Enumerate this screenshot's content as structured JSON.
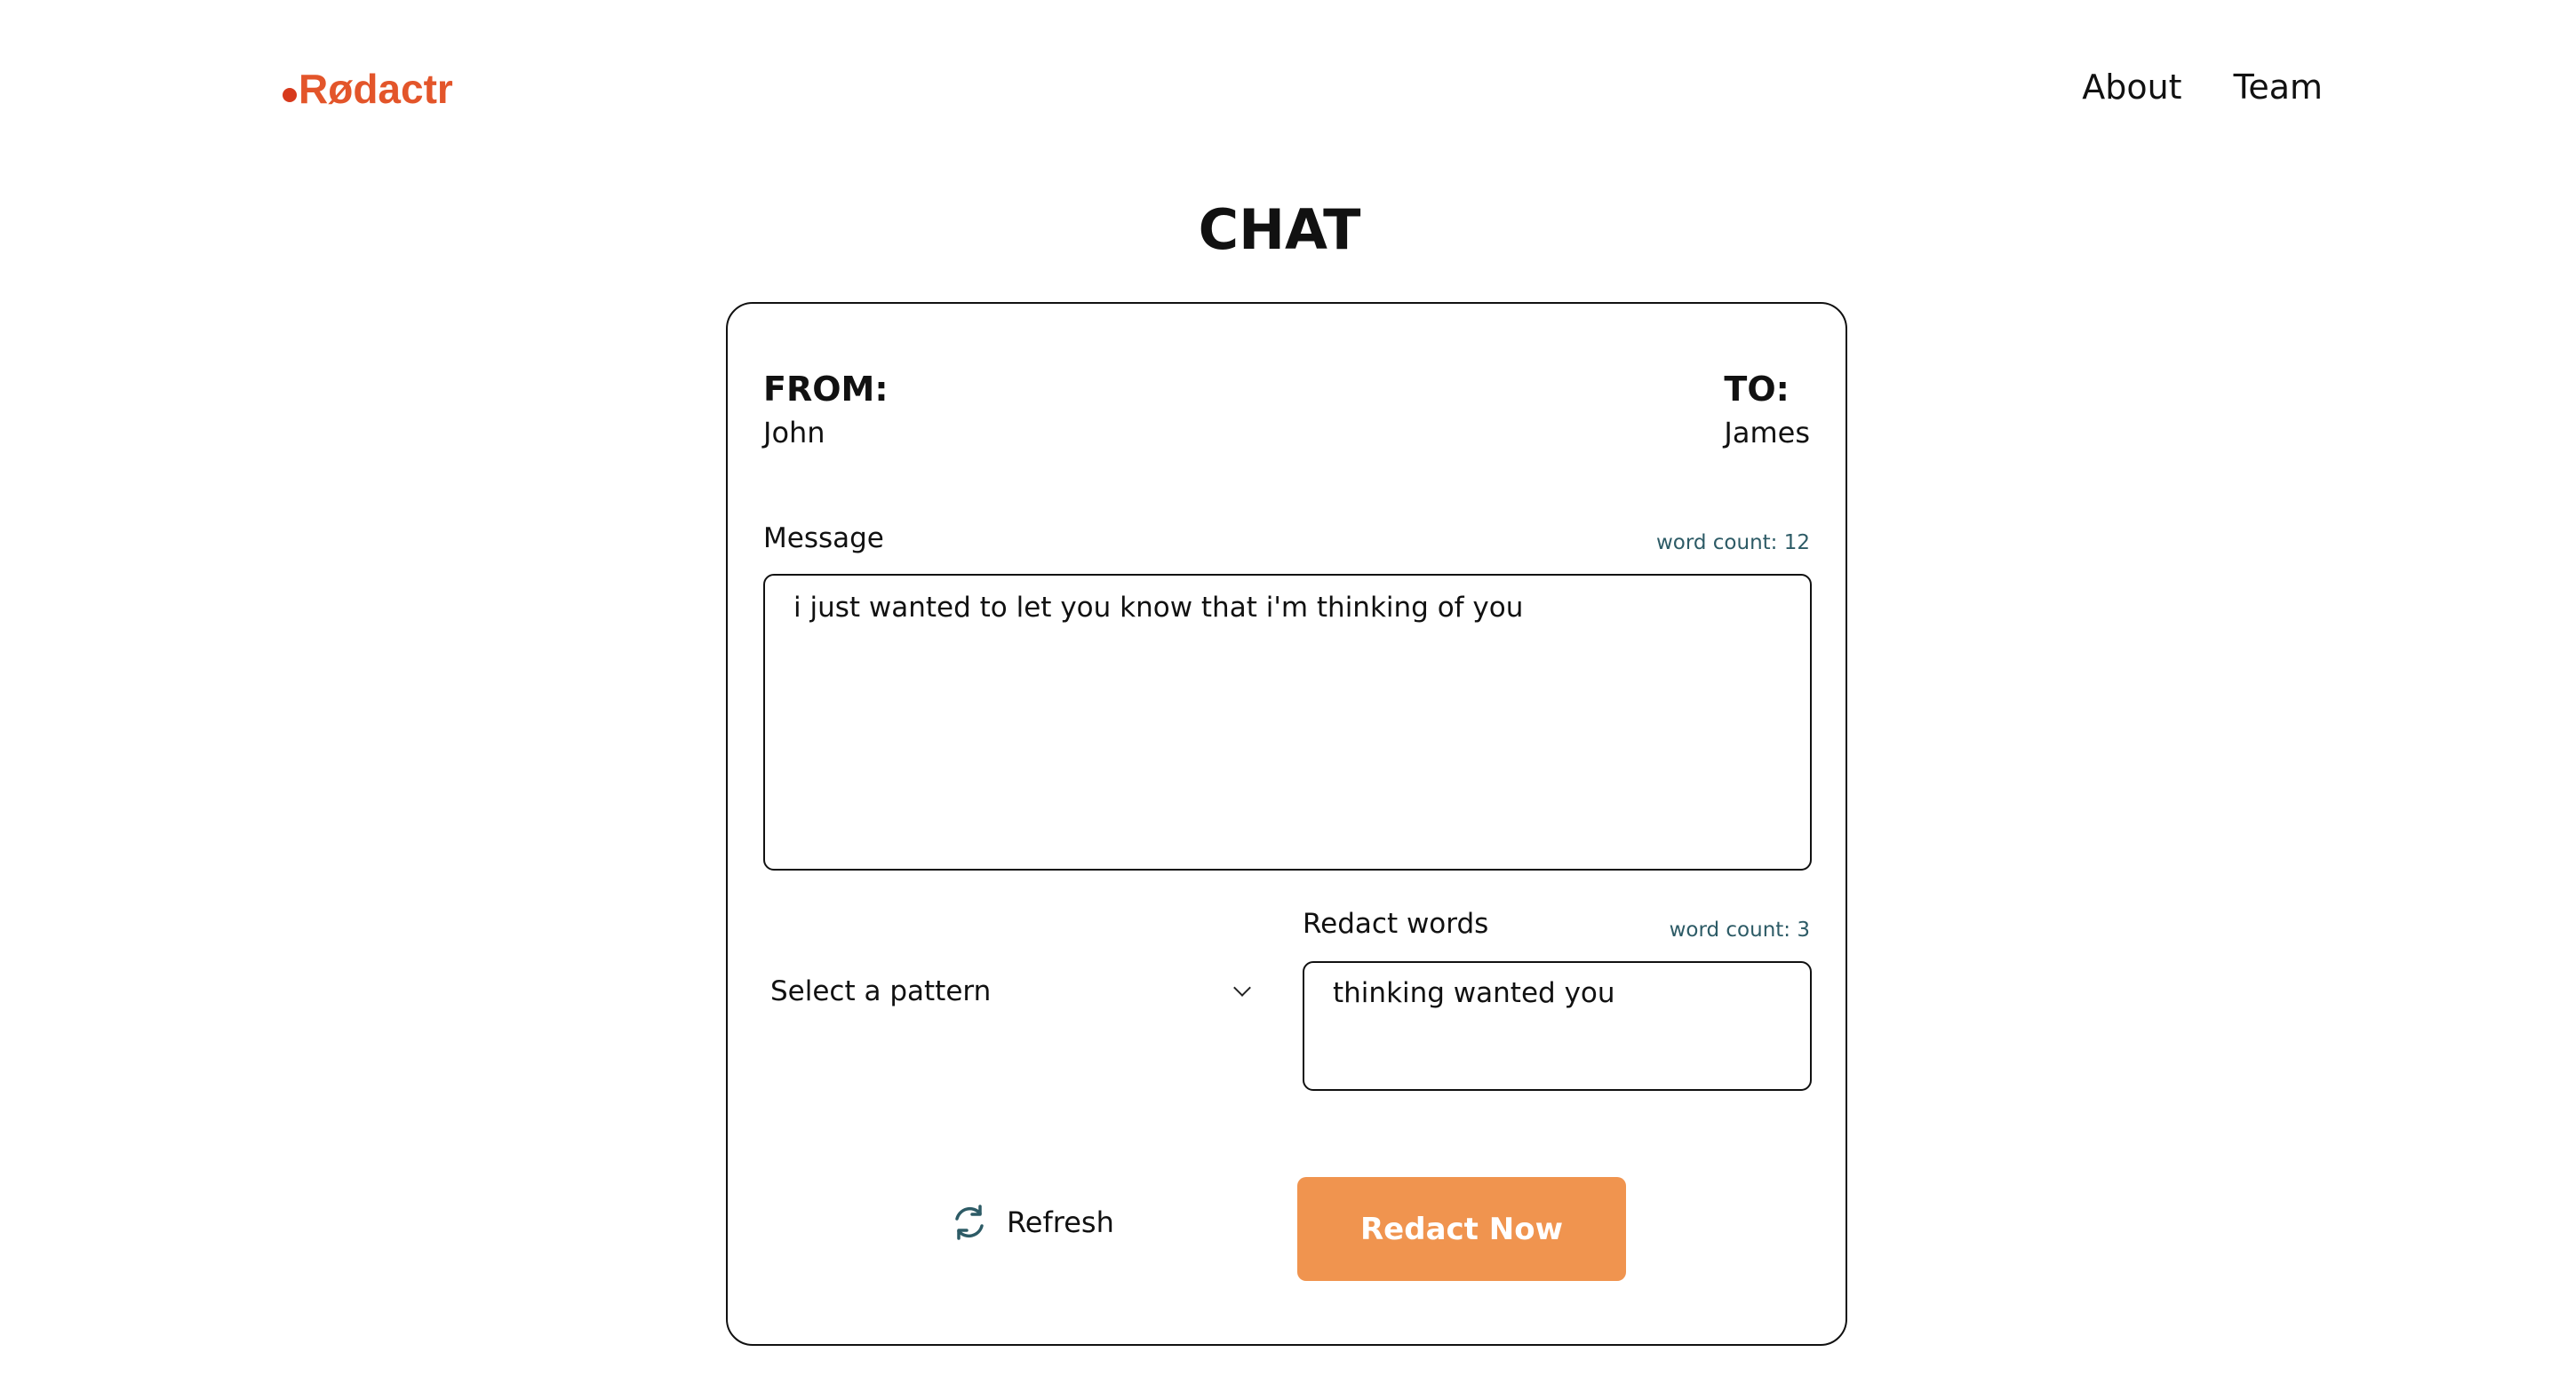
{
  "header": {
    "logo_text": "Rødactr",
    "nav": [
      {
        "label": "About"
      },
      {
        "label": "Team"
      }
    ]
  },
  "page": {
    "title": "CHAT"
  },
  "chat": {
    "from_label": "FROM:",
    "from_name": "John",
    "to_label": "TO:",
    "to_name": "James",
    "message_label": "Message",
    "message_word_count": "word count: 12",
    "message_value": "i just wanted to let you know that i'm thinking of you",
    "pattern_select": "Select a pattern",
    "redact_label": "Redact words",
    "redact_word_count": "word count: 3",
    "redact_value": "thinking wanted you",
    "refresh_label": "Refresh",
    "redact_button": "Redact Now"
  },
  "colors": {
    "brand": "#e3552a",
    "accent_button": "#f0944f",
    "word_count": "#2d5b66"
  },
  "icons": {
    "refresh": "refresh-icon",
    "chevron": "chevron-down-icon"
  }
}
